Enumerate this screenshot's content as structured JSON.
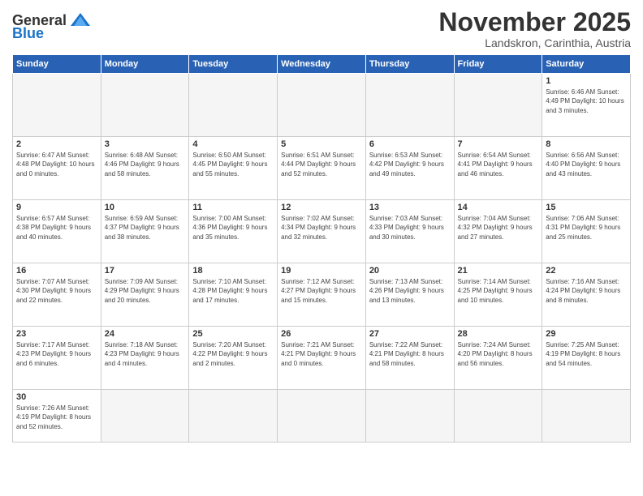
{
  "logo": {
    "general": "General",
    "blue": "Blue"
  },
  "title": "November 2025",
  "subtitle": "Landskron, Carinthia, Austria",
  "weekdays": [
    "Sunday",
    "Monday",
    "Tuesday",
    "Wednesday",
    "Thursday",
    "Friday",
    "Saturday"
  ],
  "weeks": [
    [
      {
        "day": "",
        "info": ""
      },
      {
        "day": "",
        "info": ""
      },
      {
        "day": "",
        "info": ""
      },
      {
        "day": "",
        "info": ""
      },
      {
        "day": "",
        "info": ""
      },
      {
        "day": "",
        "info": ""
      },
      {
        "day": "1",
        "info": "Sunrise: 6:46 AM\nSunset: 4:49 PM\nDaylight: 10 hours\nand 3 minutes."
      }
    ],
    [
      {
        "day": "2",
        "info": "Sunrise: 6:47 AM\nSunset: 4:48 PM\nDaylight: 10 hours\nand 0 minutes."
      },
      {
        "day": "3",
        "info": "Sunrise: 6:48 AM\nSunset: 4:46 PM\nDaylight: 9 hours\nand 58 minutes."
      },
      {
        "day": "4",
        "info": "Sunrise: 6:50 AM\nSunset: 4:45 PM\nDaylight: 9 hours\nand 55 minutes."
      },
      {
        "day": "5",
        "info": "Sunrise: 6:51 AM\nSunset: 4:44 PM\nDaylight: 9 hours\nand 52 minutes."
      },
      {
        "day": "6",
        "info": "Sunrise: 6:53 AM\nSunset: 4:42 PM\nDaylight: 9 hours\nand 49 minutes."
      },
      {
        "day": "7",
        "info": "Sunrise: 6:54 AM\nSunset: 4:41 PM\nDaylight: 9 hours\nand 46 minutes."
      },
      {
        "day": "8",
        "info": "Sunrise: 6:56 AM\nSunset: 4:40 PM\nDaylight: 9 hours\nand 43 minutes."
      }
    ],
    [
      {
        "day": "9",
        "info": "Sunrise: 6:57 AM\nSunset: 4:38 PM\nDaylight: 9 hours\nand 40 minutes."
      },
      {
        "day": "10",
        "info": "Sunrise: 6:59 AM\nSunset: 4:37 PM\nDaylight: 9 hours\nand 38 minutes."
      },
      {
        "day": "11",
        "info": "Sunrise: 7:00 AM\nSunset: 4:36 PM\nDaylight: 9 hours\nand 35 minutes."
      },
      {
        "day": "12",
        "info": "Sunrise: 7:02 AM\nSunset: 4:34 PM\nDaylight: 9 hours\nand 32 minutes."
      },
      {
        "day": "13",
        "info": "Sunrise: 7:03 AM\nSunset: 4:33 PM\nDaylight: 9 hours\nand 30 minutes."
      },
      {
        "day": "14",
        "info": "Sunrise: 7:04 AM\nSunset: 4:32 PM\nDaylight: 9 hours\nand 27 minutes."
      },
      {
        "day": "15",
        "info": "Sunrise: 7:06 AM\nSunset: 4:31 PM\nDaylight: 9 hours\nand 25 minutes."
      }
    ],
    [
      {
        "day": "16",
        "info": "Sunrise: 7:07 AM\nSunset: 4:30 PM\nDaylight: 9 hours\nand 22 minutes."
      },
      {
        "day": "17",
        "info": "Sunrise: 7:09 AM\nSunset: 4:29 PM\nDaylight: 9 hours\nand 20 minutes."
      },
      {
        "day": "18",
        "info": "Sunrise: 7:10 AM\nSunset: 4:28 PM\nDaylight: 9 hours\nand 17 minutes."
      },
      {
        "day": "19",
        "info": "Sunrise: 7:12 AM\nSunset: 4:27 PM\nDaylight: 9 hours\nand 15 minutes."
      },
      {
        "day": "20",
        "info": "Sunrise: 7:13 AM\nSunset: 4:26 PM\nDaylight: 9 hours\nand 13 minutes."
      },
      {
        "day": "21",
        "info": "Sunrise: 7:14 AM\nSunset: 4:25 PM\nDaylight: 9 hours\nand 10 minutes."
      },
      {
        "day": "22",
        "info": "Sunrise: 7:16 AM\nSunset: 4:24 PM\nDaylight: 9 hours\nand 8 minutes."
      }
    ],
    [
      {
        "day": "23",
        "info": "Sunrise: 7:17 AM\nSunset: 4:23 PM\nDaylight: 9 hours\nand 6 minutes."
      },
      {
        "day": "24",
        "info": "Sunrise: 7:18 AM\nSunset: 4:23 PM\nDaylight: 9 hours\nand 4 minutes."
      },
      {
        "day": "25",
        "info": "Sunrise: 7:20 AM\nSunset: 4:22 PM\nDaylight: 9 hours\nand 2 minutes."
      },
      {
        "day": "26",
        "info": "Sunrise: 7:21 AM\nSunset: 4:21 PM\nDaylight: 9 hours\nand 0 minutes."
      },
      {
        "day": "27",
        "info": "Sunrise: 7:22 AM\nSunset: 4:21 PM\nDaylight: 8 hours\nand 58 minutes."
      },
      {
        "day": "28",
        "info": "Sunrise: 7:24 AM\nSunset: 4:20 PM\nDaylight: 8 hours\nand 56 minutes."
      },
      {
        "day": "29",
        "info": "Sunrise: 7:25 AM\nSunset: 4:19 PM\nDaylight: 8 hours\nand 54 minutes."
      }
    ],
    [
      {
        "day": "30",
        "info": "Sunrise: 7:26 AM\nSunset: 4:19 PM\nDaylight: 8 hours\nand 52 minutes."
      },
      {
        "day": "",
        "info": ""
      },
      {
        "day": "",
        "info": ""
      },
      {
        "day": "",
        "info": ""
      },
      {
        "day": "",
        "info": ""
      },
      {
        "day": "",
        "info": ""
      },
      {
        "day": "",
        "info": ""
      }
    ]
  ]
}
